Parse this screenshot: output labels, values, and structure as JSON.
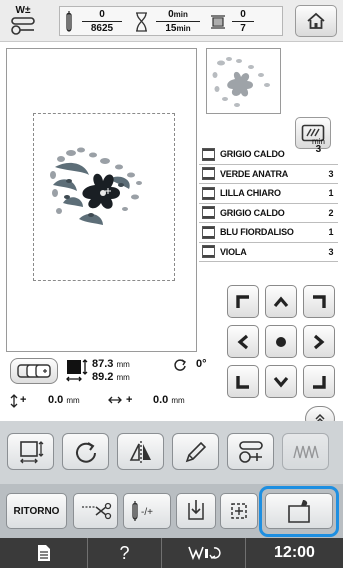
{
  "top_bar": {
    "presser_label": "W±",
    "stitch_done": "0",
    "stitch_total": "8625",
    "time_done": "0",
    "time_total": "15",
    "time_unit": "min",
    "color_done": "0",
    "color_total": "7"
  },
  "threads": {
    "min_label": "min",
    "min_value": "3",
    "items": [
      {
        "name": "GRIGIO CALDO",
        "minutes": ""
      },
      {
        "name": "VERDE ANATRA",
        "minutes": "3"
      },
      {
        "name": "LILLA CHIARO",
        "minutes": "1"
      },
      {
        "name": "GRIGIO CALDO",
        "minutes": "2"
      },
      {
        "name": "BLU FIORDALISO",
        "minutes": "1"
      },
      {
        "name": "VIOLA",
        "minutes": "3"
      }
    ]
  },
  "pattern_info": {
    "height_value": "87.3",
    "width_value": "89.2",
    "size_unit": "mm",
    "rotation_value": "0°",
    "offset_y_value": "0.0",
    "offset_x_value": "0.0",
    "offset_unit": "mm",
    "plus_sign": "+"
  },
  "bottom_bar": {
    "return_label": "RITORNO"
  },
  "status_bar": {
    "help_label": "?",
    "clock": "12:00"
  },
  "colors": {
    "highlight": "#1e8fe1",
    "status_bar": "#3a3a3a",
    "edit_bar": "#cfd3d6"
  }
}
